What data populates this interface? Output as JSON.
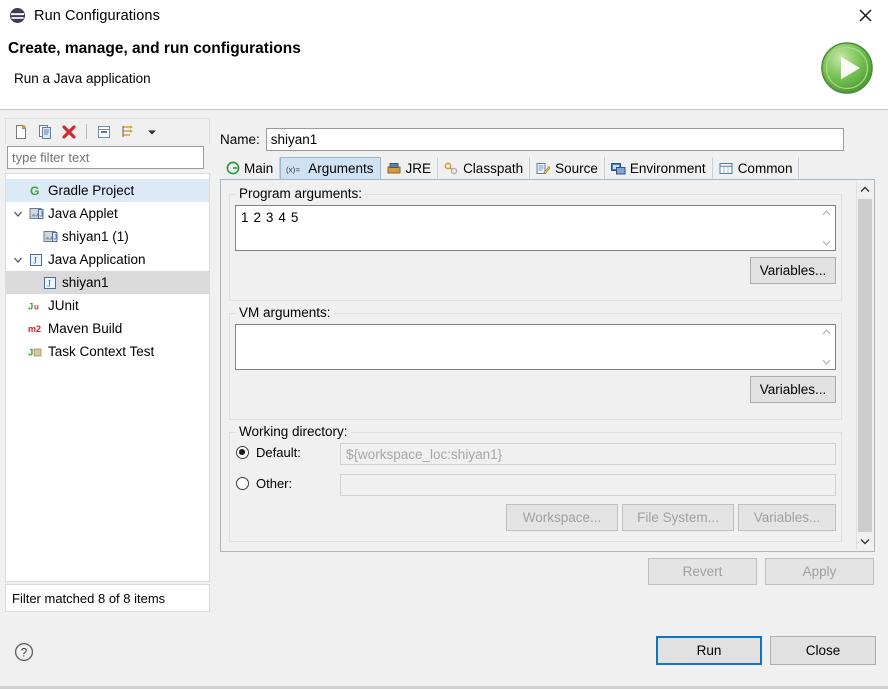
{
  "window": {
    "title": "Run Configurations",
    "icon": "eclipse-logo-icon",
    "close_label": "close-icon"
  },
  "header": {
    "title": "Create, manage, and run configurations",
    "subtitle": "Run a Java application",
    "banner_icon": "green-run-arrow-icon"
  },
  "left_panel": {
    "toolbar": [
      {
        "name": "new-launch-configuration-button",
        "icon": "new-document-icon"
      },
      {
        "name": "duplicate-launch-configuration-button",
        "icon": "copy-icon"
      },
      {
        "name": "delete-launch-configuration-button",
        "icon": "red-x-delete-icon"
      },
      {
        "name": "collapse-all-button",
        "icon": "collapse-all-icon"
      },
      {
        "name": "filter-launch-configurations-button",
        "icon": "filter-arrows-icon"
      },
      {
        "name": "view-menu-button",
        "icon": "chevron-down-icon"
      }
    ],
    "filter": {
      "value": "",
      "placeholder": "type filter text"
    },
    "tree": [
      {
        "label": "Gradle Project",
        "icon": "gradle-icon",
        "depth": 0,
        "twisty": "none",
        "state": "hover"
      },
      {
        "label": "Java Applet",
        "icon": "java-applet-icon",
        "depth": 0,
        "twisty": "expanded",
        "state": "normal"
      },
      {
        "label": "shiyan1 (1)",
        "icon": "java-applet-icon",
        "depth": 1,
        "twisty": "none",
        "state": "normal"
      },
      {
        "label": "Java Application",
        "icon": "java-application-icon",
        "depth": 0,
        "twisty": "expanded",
        "state": "normal"
      },
      {
        "label": "shiyan1",
        "icon": "java-application-icon",
        "depth": 1,
        "twisty": "none",
        "state": "selected"
      },
      {
        "label": "JUnit",
        "icon": "junit-icon",
        "depth": 0,
        "twisty": "none",
        "state": "normal"
      },
      {
        "label": "Maven Build",
        "icon": "maven-icon",
        "depth": 0,
        "twisty": "none",
        "state": "normal"
      },
      {
        "label": "Task Context Test",
        "icon": "task-context-test-icon",
        "depth": 0,
        "twisty": "none",
        "state": "normal"
      }
    ],
    "status": "Filter matched 8 of 8 items"
  },
  "right_panel": {
    "name_label": "Name:",
    "name_value": "shiyan1",
    "tabs": [
      {
        "label": "Main",
        "icon": "main-tab-icon",
        "active": false
      },
      {
        "label": "Arguments",
        "icon": "arguments-tab-icon",
        "active": true
      },
      {
        "label": "JRE",
        "icon": "jre-tab-icon",
        "active": false
      },
      {
        "label": "Classpath",
        "icon": "classpath-tab-icon",
        "active": false
      },
      {
        "label": "Source",
        "icon": "source-tab-icon",
        "active": false
      },
      {
        "label": "Environment",
        "icon": "environment-tab-icon",
        "active": false
      },
      {
        "label": "Common",
        "icon": "common-tab-icon",
        "active": false
      }
    ],
    "program_arguments": {
      "group_label": "Program arguments:",
      "value": "1 2 3 4 5",
      "variables_button": "Variables..."
    },
    "vm_arguments": {
      "group_label": "VM arguments:",
      "value": "",
      "variables_button": "Variables..."
    },
    "working_directory": {
      "group_label": "Working directory:",
      "default_label": "Default:",
      "default_selected": true,
      "default_value": "${workspace_loc:shiyan1}",
      "other_label": "Other:",
      "other_selected": false,
      "other_value": "",
      "workspace_button": "Workspace...",
      "file_system_button": "File System...",
      "variables_button": "Variables..."
    },
    "revert_button": "Revert",
    "apply_button": "Apply"
  },
  "footer": {
    "help_icon": "help-question-icon",
    "run_button": "Run",
    "close_button": "Close"
  },
  "colors": {
    "accent": "#1275c4",
    "tab_active": "#cfe2f3",
    "tree_hover": "#dceaf7",
    "tree_selected": "#dadada",
    "panel_bg": "#f0f0f0"
  }
}
